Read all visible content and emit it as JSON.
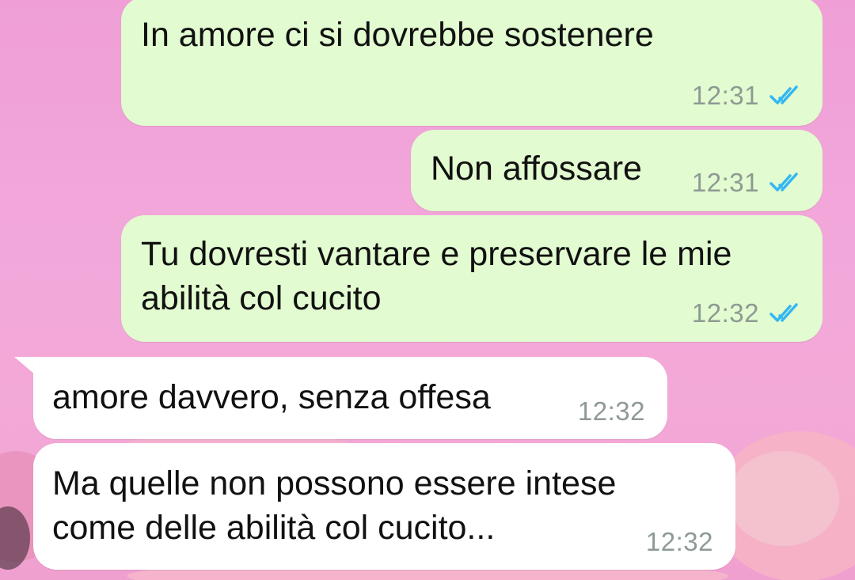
{
  "messages": [
    {
      "direction": "outgoing",
      "text": "In amore ci si dovrebbe sostenere",
      "time": "12:31",
      "status": "read",
      "status_icon": "double-check-icon"
    },
    {
      "direction": "outgoing",
      "text": "Non affossare",
      "time": "12:31",
      "status": "read",
      "status_icon": "double-check-icon"
    },
    {
      "direction": "outgoing",
      "text": "Tu dovresti vantare e preservare le mie\nabilità col cucito",
      "time": "12:32",
      "status": "read",
      "status_icon": "double-check-icon"
    },
    {
      "direction": "incoming",
      "text": "amore davvero, senza offesa",
      "time": "12:32"
    },
    {
      "direction": "incoming",
      "text": "Ma quelle non possono essere intese\ncome delle abilità col cucito...",
      "time": "12:32"
    }
  ],
  "colors": {
    "outgoing_bubble": "#e2fbd0",
    "incoming_bubble": "#ffffff",
    "read_ticks": "#34b7f1",
    "timestamp": "#8e9a93",
    "wallpaper": "#f2a7da"
  }
}
